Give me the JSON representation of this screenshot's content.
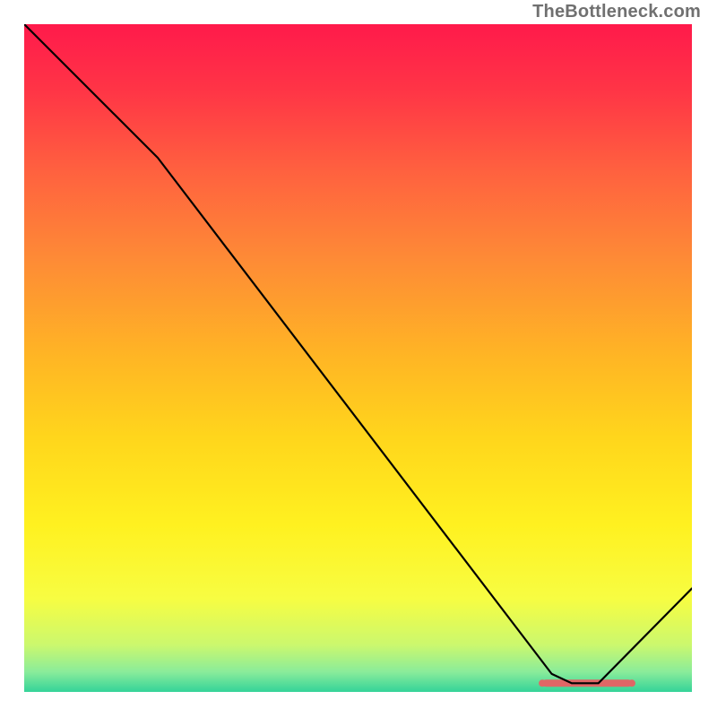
{
  "watermark": "TheBottleneck.com",
  "chart_data": {
    "type": "line",
    "title": "",
    "xlabel": "",
    "ylabel": "",
    "xlim": [
      0,
      1
    ],
    "ylim": [
      0,
      1
    ],
    "series": [
      {
        "name": "curve",
        "points": [
          {
            "x": 0.0,
            "y": 1.0
          },
          {
            "x": 0.2,
            "y": 0.8
          },
          {
            "x": 0.79,
            "y": 0.027
          },
          {
            "x": 0.82,
            "y": 0.013
          },
          {
            "x": 0.86,
            "y": 0.013
          },
          {
            "x": 1.0,
            "y": 0.155
          }
        ]
      }
    ],
    "marker": {
      "center_x": 0.843,
      "y": 0.013,
      "half_width": 0.067,
      "color": "#e06666"
    },
    "gradient_stops": [
      {
        "offset": 0.0,
        "color": "#ff1a4b"
      },
      {
        "offset": 0.1,
        "color": "#ff3546"
      },
      {
        "offset": 0.22,
        "color": "#ff613f"
      },
      {
        "offset": 0.35,
        "color": "#fe8a36"
      },
      {
        "offset": 0.5,
        "color": "#ffb624"
      },
      {
        "offset": 0.62,
        "color": "#ffd61c"
      },
      {
        "offset": 0.75,
        "color": "#fff120"
      },
      {
        "offset": 0.86,
        "color": "#f7fd42"
      },
      {
        "offset": 0.93,
        "color": "#cbf86e"
      },
      {
        "offset": 0.97,
        "color": "#8aec9a"
      },
      {
        "offset": 1.0,
        "color": "#34d399"
      }
    ]
  }
}
